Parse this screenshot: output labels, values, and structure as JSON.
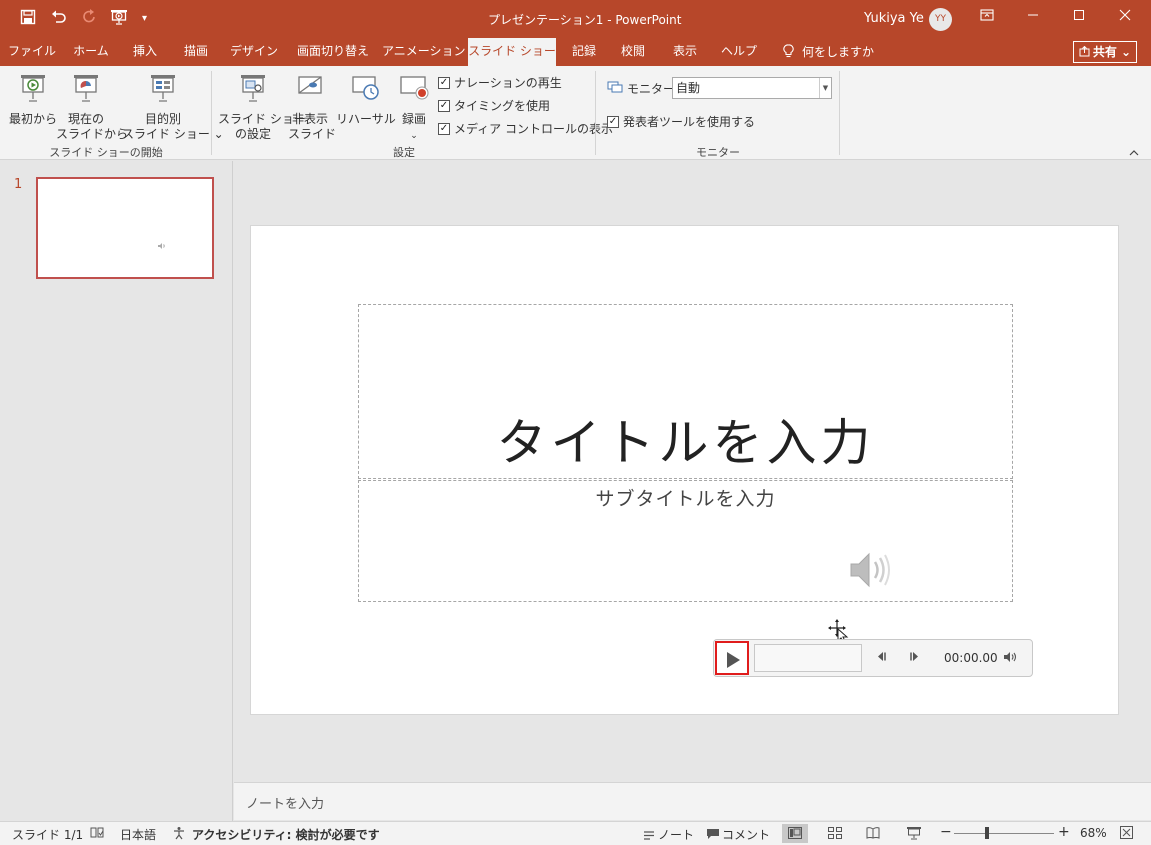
{
  "app": {
    "window_title": "プレゼンテーション1  -  PowerPoint",
    "user_name": "Yukiya Ye",
    "user_initials": "YY",
    "accent_color": "#b7472a"
  },
  "quick_access": {
    "save_icon": "save-icon",
    "undo_icon": "undo-icon",
    "redo_icon": "redo-icon",
    "present_icon": "present-from-beginning-icon",
    "customize_icon": "customize-qat-icon"
  },
  "window_controls": {
    "ribbon_display": "ribbon-display-options-icon",
    "minimize": "minimize-icon",
    "maximize": "maximize-icon",
    "close": "close-icon"
  },
  "tabs": [
    {
      "label": "ファイル"
    },
    {
      "label": "ホーム"
    },
    {
      "label": "挿入"
    },
    {
      "label": "描画"
    },
    {
      "label": "デザイン"
    },
    {
      "label": "画面切り替え"
    },
    {
      "label": "アニメーション"
    },
    {
      "label": "スライド ショー",
      "active": true
    },
    {
      "label": "記録"
    },
    {
      "label": "校閲"
    },
    {
      "label": "表示"
    },
    {
      "label": "ヘルプ"
    }
  ],
  "tell_me": "何をしますか",
  "share_label": "共有 ⌄",
  "ribbon": {
    "start": {
      "from_beginning_line1": "最初から",
      "from_current_line1": "現在の",
      "from_current_line2": "スライドから",
      "custom_line1": "目的別",
      "custom_line2": "スライド ショー ⌄",
      "group_label": "スライド ショーの開始"
    },
    "setup": {
      "setup_line1": "スライド ショー",
      "setup_line2": "の設定",
      "hide_line1": "非表示",
      "hide_line2": "スライド",
      "rehearse": "リハーサル",
      "record": "録画",
      "record_arrow": "⌄",
      "chk_narration": "ナレーションの再生",
      "chk_timings": "タイミングを使用",
      "chk_media": "メディア コントロールの表示",
      "group_label": "設定"
    },
    "monitors": {
      "monitor_label": "モニター:",
      "monitor_value": "自動",
      "presenter_view": "発表者ツールを使用する",
      "group_label": "モニター"
    }
  },
  "thumbnails": {
    "slide_number": "1"
  },
  "slide": {
    "title_placeholder": "タイトルを入力",
    "subtitle_placeholder": "サブタイトルを入力"
  },
  "media": {
    "time": "00:00.00"
  },
  "notes_placeholder": "ノートを入力",
  "status": {
    "slide_info": "スライド 1/1",
    "language": "日本語",
    "accessibility": "アクセシビリティ: 検討が必要です",
    "notes": "ノート",
    "comments": "コメント",
    "zoom": "68%"
  }
}
